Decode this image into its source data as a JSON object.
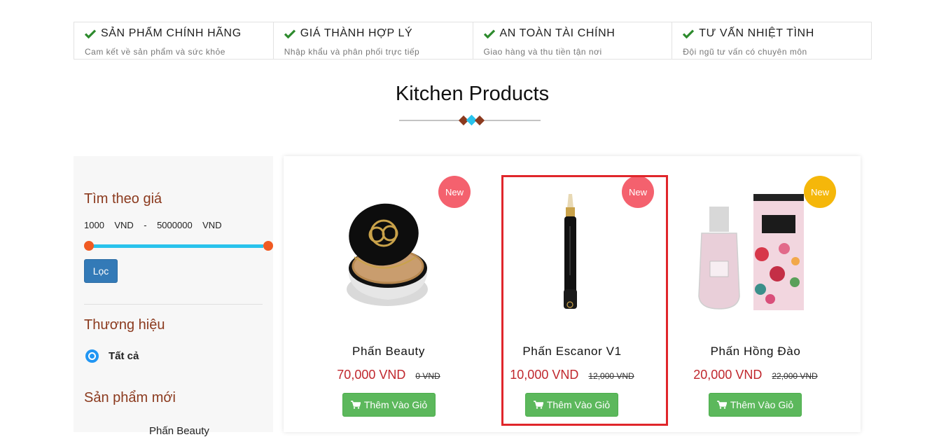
{
  "features": [
    {
      "title": "SẢN PHẨM CHÍNH HÃNG",
      "subtitle": "Cam kết về sản phẩm và sức khỏe"
    },
    {
      "title": "GIÁ THÀNH HỢP LÝ",
      "subtitle": "Nhập khẩu và phân phối trực tiếp"
    },
    {
      "title": "AN TOÀN TÀI CHÍNH",
      "subtitle": "Giao hàng và thu tiền tận nơi"
    },
    {
      "title": "TƯ VẤN NHIỆT TÌNH",
      "subtitle": "Đội ngũ tư vấn có chuyên môn"
    }
  ],
  "section_title": "Kitchen Products",
  "sidebar": {
    "price_heading": "Tìm theo giá",
    "price_min": "1000",
    "price_max": "5000000",
    "currency": "VND",
    "filter_button": "Lọc",
    "brand_heading": "Thương hiệu",
    "brand_all": "Tất cả",
    "new_heading": "Sản phẩm mới",
    "new_product_name": "Phấn Beauty"
  },
  "products": [
    {
      "name": "Phấn Beauty",
      "price": "70,000 VND",
      "old_price": "0 VND",
      "badge": "New",
      "badge_color": "#f4616e",
      "button": "Thêm Vào Giỏ"
    },
    {
      "name": "Phấn Escanor V1",
      "price": "10,000 VND",
      "old_price": "12,000 VND",
      "badge": "New",
      "badge_color": "#f4616e",
      "button": "Thêm Vào Giỏ"
    },
    {
      "name": "Phấn Hồng Đào",
      "price": "20,000 VND",
      "old_price": "22,000 VND",
      "badge": "New",
      "badge_color": "#f5b70a",
      "button": "Thêm Vào Giỏ"
    }
  ],
  "icons": {
    "check": "check-icon",
    "cart": "cart-icon"
  },
  "colors": {
    "accent_brown": "#8b3a1e",
    "price_red": "#c0272d",
    "green": "#5cb85c",
    "blue": "#337ab7",
    "slider": "#29c3ec"
  }
}
